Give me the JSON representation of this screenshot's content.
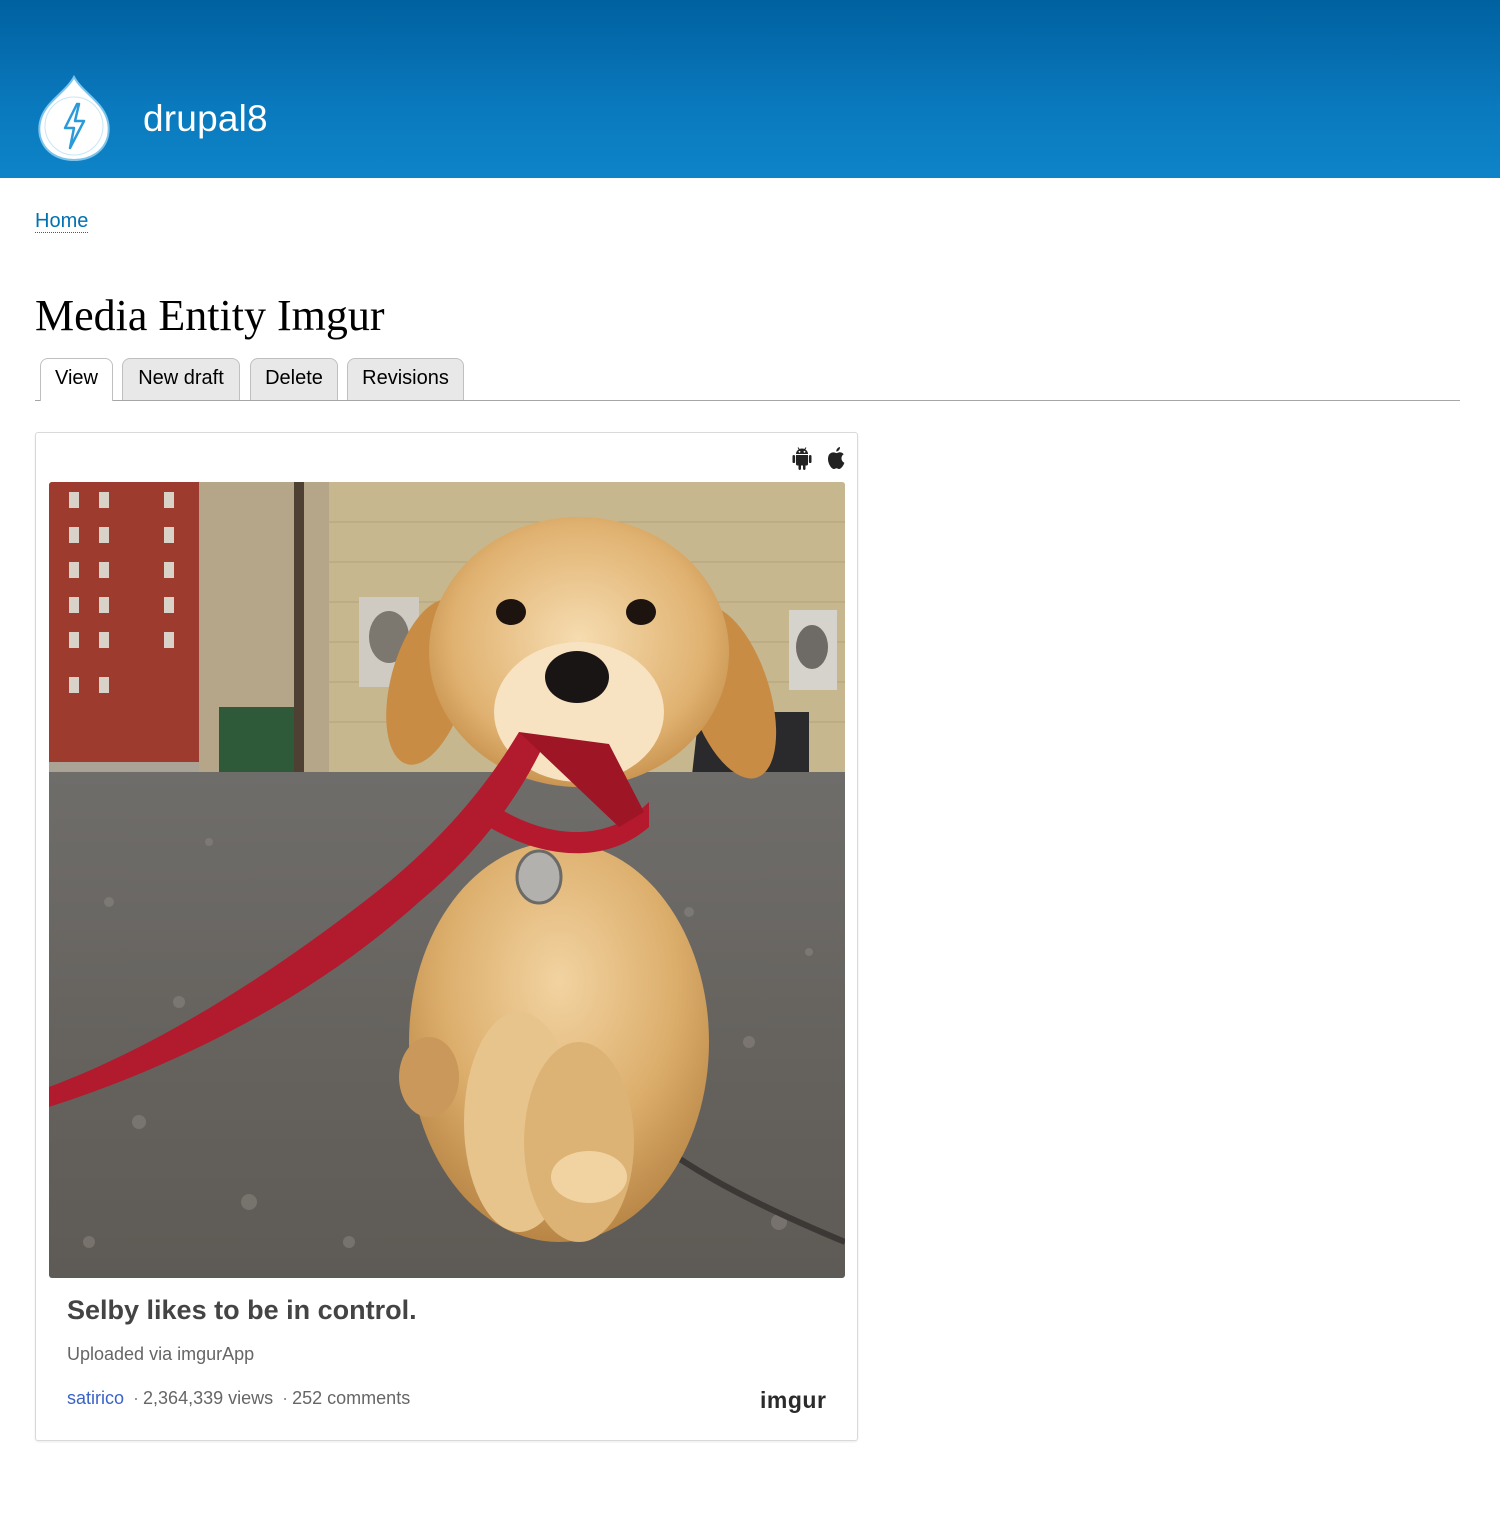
{
  "header": {
    "site_name": "drupal8",
    "logo_icon": "drupal-drop-logo-icon",
    "brand_color": "#0a79bd"
  },
  "breadcrumb": {
    "home_label": "Home"
  },
  "page": {
    "title": "Media Entity Imgur"
  },
  "tabs": [
    {
      "label": "View",
      "active": true
    },
    {
      "label": "New draft",
      "active": false
    },
    {
      "label": "Delete",
      "active": false
    },
    {
      "label": "Revisions",
      "active": false
    }
  ],
  "embed": {
    "app_icons": [
      "android-icon",
      "apple-icon"
    ],
    "image_alt": "golden retriever puppy holding red leash",
    "caption_title": "Selby likes to be in control.",
    "caption_sub": "Uploaded via imgurApp",
    "author": "satirico",
    "separator": "·",
    "views": "2,364,339 views",
    "comments": "252 comments",
    "provider": "imgur",
    "link_color": "#3a62c9"
  }
}
